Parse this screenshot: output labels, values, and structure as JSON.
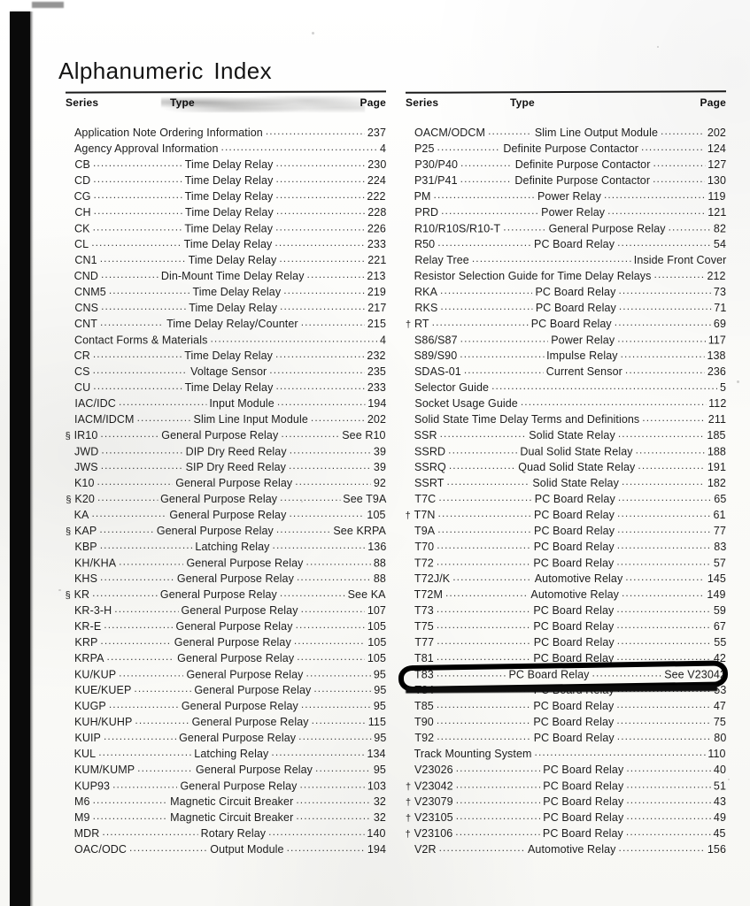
{
  "document": {
    "title": "Alphanumeric Index"
  },
  "columns": [
    {
      "id": "left",
      "headers": {
        "series": "Series",
        "type": "Type",
        "page": "Page"
      },
      "rows": [
        {
          "mark": "",
          "series": "Application Note Ordering Information",
          "type": "",
          "page": "237",
          "wide": true
        },
        {
          "mark": "",
          "series": "Agency Approval Information",
          "type": "",
          "page": "4",
          "wide": true
        },
        {
          "mark": "",
          "series": "CB",
          "type": "Time Delay Relay",
          "page": "230"
        },
        {
          "mark": "",
          "series": "CD",
          "type": "Time Delay Relay",
          "page": "224"
        },
        {
          "mark": "",
          "series": "CG",
          "type": "Time Delay Relay",
          "page": "222"
        },
        {
          "mark": "",
          "series": "CH",
          "type": "Time Delay Relay",
          "page": "228"
        },
        {
          "mark": "",
          "series": "CK",
          "type": "Time Delay Relay",
          "page": "226"
        },
        {
          "mark": "",
          "series": "CL",
          "type": "Time Delay Relay",
          "page": "233"
        },
        {
          "mark": "",
          "series": "CN1",
          "type": "Time Delay Relay",
          "page": "221"
        },
        {
          "mark": "",
          "series": "CND",
          "type": "Din-Mount Time Delay Relay",
          "page": "213"
        },
        {
          "mark": "",
          "series": "CNM5",
          "type": "Time Delay Relay",
          "page": "219"
        },
        {
          "mark": "",
          "series": "CNS",
          "type": "Time Delay Relay",
          "page": "217"
        },
        {
          "mark": "",
          "series": "CNT",
          "type": "Time Delay Relay/Counter",
          "page": "215"
        },
        {
          "mark": "",
          "series": "Contact Forms & Materials",
          "type": "",
          "page": "4",
          "wide": true
        },
        {
          "mark": "",
          "series": "CR",
          "type": "Time Delay Relay",
          "page": "232"
        },
        {
          "mark": "",
          "series": "CS",
          "type": "Voltage Sensor",
          "page": "235"
        },
        {
          "mark": "",
          "series": "CU",
          "type": "Time Delay Relay",
          "page": "233"
        },
        {
          "mark": "",
          "series": "IAC/IDC",
          "type": "Input Module",
          "page": "194"
        },
        {
          "mark": "",
          "series": "IACM/IDCM",
          "type": "Slim Line Input Module",
          "page": "202"
        },
        {
          "mark": "§",
          "series": "IR10",
          "type": "General Purpose Relay",
          "page": "See R10"
        },
        {
          "mark": "",
          "series": "JWD",
          "type": "DIP Dry Reed Relay",
          "page": "39"
        },
        {
          "mark": "",
          "series": "JWS",
          "type": "SIP Dry Reed Relay",
          "page": "39"
        },
        {
          "mark": "",
          "series": "K10",
          "type": "General Purpose Relay",
          "page": "92"
        },
        {
          "mark": "§",
          "series": "K20",
          "type": "General Purpose Relay",
          "page": "See T9A"
        },
        {
          "mark": "",
          "series": "KA",
          "type": "General Purpose Relay",
          "page": "105"
        },
        {
          "mark": "§",
          "series": "KAP",
          "type": "General Purpose Relay",
          "page": "See KRPA"
        },
        {
          "mark": "",
          "series": "KBP",
          "type": "Latching Relay",
          "page": "136"
        },
        {
          "mark": "",
          "series": "KH/KHA",
          "type": "General Purpose Relay",
          "page": "88"
        },
        {
          "mark": "",
          "series": "KHS",
          "type": "General Purpose Relay",
          "page": "88"
        },
        {
          "mark": "§",
          "series": "KR",
          "type": "General Purpose Relay",
          "page": "See KA"
        },
        {
          "mark": "",
          "series": "KR-3-H",
          "type": "General Purpose Relay",
          "page": "107"
        },
        {
          "mark": "",
          "series": "KR-E",
          "type": "General Purpose Relay",
          "page": "105"
        },
        {
          "mark": "",
          "series": "KRP",
          "type": "General Purpose Relay",
          "page": "105"
        },
        {
          "mark": "",
          "series": "KRPA",
          "type": "General Purpose Relay",
          "page": "105"
        },
        {
          "mark": "",
          "series": "KU/KUP",
          "type": "General Purpose Relay",
          "page": "95"
        },
        {
          "mark": "",
          "series": "KUE/KUEP",
          "type": "General Purpose Relay",
          "page": "95"
        },
        {
          "mark": "",
          "series": "KUGP",
          "type": "General Purpose Relay",
          "page": "95"
        },
        {
          "mark": "",
          "series": "KUH/KUHP",
          "type": "General Purpose Relay",
          "page": "115"
        },
        {
          "mark": "",
          "series": "KUIP",
          "type": "General Purpose Relay",
          "page": "95"
        },
        {
          "mark": "",
          "series": "KUL",
          "type": "Latching Relay",
          "page": "134"
        },
        {
          "mark": "",
          "series": "KUM/KUMP",
          "type": "General Purpose Relay",
          "page": "95"
        },
        {
          "mark": "",
          "series": "KUP93",
          "type": "General Purpose Relay",
          "page": "103"
        },
        {
          "mark": "",
          "series": "M6",
          "type": "Magnetic Circuit Breaker",
          "page": "32"
        },
        {
          "mark": "",
          "series": "M9",
          "type": "Magnetic Circuit Breaker",
          "page": "32"
        },
        {
          "mark": "",
          "series": "MDR",
          "type": "Rotary Relay",
          "page": "140"
        },
        {
          "mark": "",
          "series": "OAC/ODC",
          "type": "Output Module",
          "page": "194"
        }
      ]
    },
    {
      "id": "right",
      "headers": {
        "series": "Series",
        "type": "Type",
        "page": "Page"
      },
      "rows": [
        {
          "mark": "",
          "series": "OACM/ODCM",
          "type": "Slim Line Output Module",
          "page": "202"
        },
        {
          "mark": "",
          "series": "P25",
          "type": "Definite Purpose Contactor",
          "page": "124"
        },
        {
          "mark": "",
          "series": "P30/P40",
          "type": "Definite Purpose Contactor",
          "page": "127"
        },
        {
          "mark": "",
          "series": "P31/P41",
          "type": "Definite Purpose Contactor",
          "page": "130"
        },
        {
          "mark": "",
          "series": "PM",
          "type": "Power Relay",
          "page": "119"
        },
        {
          "mark": "",
          "series": "PRD",
          "type": "Power Relay",
          "page": "121"
        },
        {
          "mark": "",
          "series": "R10/R10S/R10-T",
          "type": "General Purpose Relay",
          "page": "82"
        },
        {
          "mark": "",
          "series": "R50",
          "type": "PC Board Relay",
          "page": "54"
        },
        {
          "mark": "",
          "series": "Relay Tree",
          "type": "",
          "page": "Inside Front Cover",
          "wide": true
        },
        {
          "mark": "",
          "series": "Resistor Selection Guide for Time Delay Relays",
          "type": "",
          "page": "212",
          "wide": true
        },
        {
          "mark": "",
          "series": "RKA",
          "type": "PC Board Relay",
          "page": "73"
        },
        {
          "mark": "",
          "series": "RKS",
          "type": "PC Board Relay",
          "page": "71"
        },
        {
          "mark": "†",
          "series": "RT",
          "type": "PC Board Relay",
          "page": "69"
        },
        {
          "mark": "",
          "series": "S86/S87",
          "type": "Power Relay",
          "page": "117"
        },
        {
          "mark": "",
          "series": "S89/S90",
          "type": "Impulse Relay",
          "page": "138"
        },
        {
          "mark": "",
          "series": "SDAS-01",
          "type": "Current Sensor",
          "page": "236"
        },
        {
          "mark": "",
          "series": "Selector Guide",
          "type": "",
          "page": "5",
          "wide": true
        },
        {
          "mark": "",
          "series": "Socket Usage Guide",
          "type": "",
          "page": "112",
          "wide": true
        },
        {
          "mark": "",
          "series": "Solid State Time Delay Terms and Definitions",
          "type": "",
          "page": "211",
          "wide": true
        },
        {
          "mark": "",
          "series": "SSR",
          "type": "Solid State Relay",
          "page": "185"
        },
        {
          "mark": "",
          "series": "SSRD",
          "type": "Dual Solid State Relay",
          "page": "188"
        },
        {
          "mark": "",
          "series": "SSRQ",
          "type": "Quad Solid State Relay",
          "page": "191"
        },
        {
          "mark": "",
          "series": "SSRT",
          "type": "Solid State Relay",
          "page": "182"
        },
        {
          "mark": "",
          "series": "T7C",
          "type": "PC Board Relay",
          "page": "65"
        },
        {
          "mark": "†",
          "series": "T7N",
          "type": "PC Board Relay",
          "page": "61"
        },
        {
          "mark": "",
          "series": "T9A",
          "type": "PC Board Relay",
          "page": "77"
        },
        {
          "mark": "",
          "series": "T70",
          "type": "PC Board Relay",
          "page": "83"
        },
        {
          "mark": "",
          "series": "T72",
          "type": "PC Board Relay",
          "page": "57"
        },
        {
          "mark": "",
          "series": "T72J/K",
          "type": "Automotive Relay",
          "page": "145"
        },
        {
          "mark": "",
          "series": "T72M",
          "type": "Automotive Relay",
          "page": "149"
        },
        {
          "mark": "",
          "series": "T73",
          "type": "PC Board Relay",
          "page": "59"
        },
        {
          "mark": "",
          "series": "T75",
          "type": "PC Board Relay",
          "page": "67"
        },
        {
          "mark": "",
          "series": "T77",
          "type": "PC Board Relay",
          "page": "55"
        },
        {
          "mark": "",
          "series": "T81",
          "type": "PC Board Relay",
          "page": "42"
        },
        {
          "mark": "",
          "series": "T83",
          "type": "PC Board Relay",
          "page": "See V23042",
          "highlighted": true
        },
        {
          "mark": "",
          "series": "T84",
          "type": "PC Board Relay",
          "page": "53"
        },
        {
          "mark": "",
          "series": "T85",
          "type": "PC Board Relay",
          "page": "47"
        },
        {
          "mark": "",
          "series": "T90",
          "type": "PC Board Relay",
          "page": "75"
        },
        {
          "mark": "",
          "series": "T92",
          "type": "PC Board Relay",
          "page": "80"
        },
        {
          "mark": "",
          "series": "Track Mounting System",
          "type": "",
          "page": "110",
          "wide": true
        },
        {
          "mark": "",
          "series": "V23026",
          "type": "PC Board Relay",
          "page": "40"
        },
        {
          "mark": "†",
          "series": "V23042",
          "type": "PC Board Relay",
          "page": "51"
        },
        {
          "mark": "†",
          "series": "V23079",
          "type": "PC Board Relay",
          "page": "43"
        },
        {
          "mark": "†",
          "series": "V23105",
          "type": "PC Board Relay",
          "page": "49"
        },
        {
          "mark": "†",
          "series": "V23106",
          "type": "PC Board Relay",
          "page": "45"
        },
        {
          "mark": "",
          "series": "V2R",
          "type": "Automotive Relay",
          "page": "156"
        }
      ]
    }
  ],
  "annotations": {
    "highlight_target": "T83",
    "highlight_color": "#000000",
    "highlight_shape": "hand-drawn-oval"
  }
}
